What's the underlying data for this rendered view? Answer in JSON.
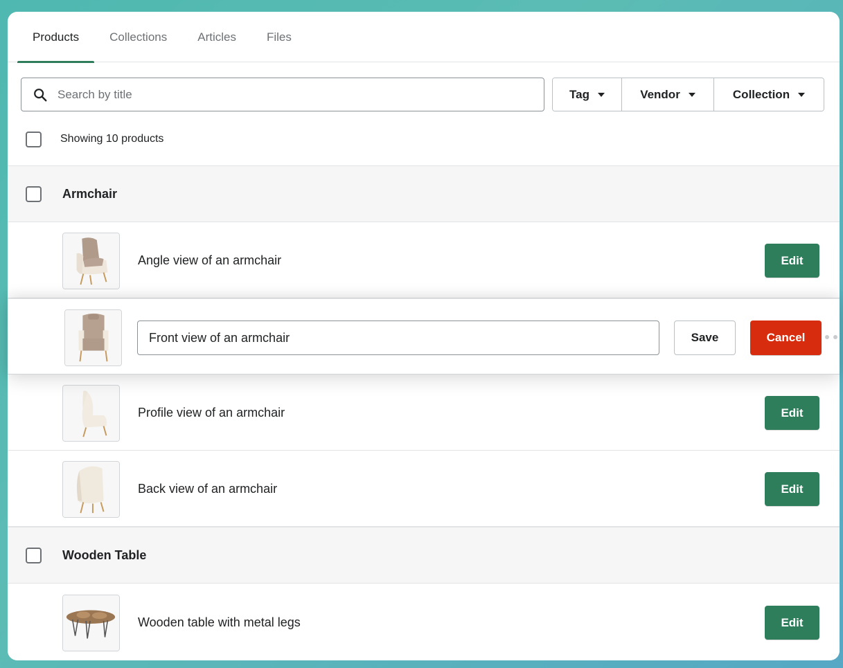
{
  "tabs": [
    {
      "label": "Products",
      "active": true
    },
    {
      "label": "Collections",
      "active": false
    },
    {
      "label": "Articles",
      "active": false
    },
    {
      "label": "Files",
      "active": false
    }
  ],
  "search": {
    "placeholder": "Search by title",
    "value": ""
  },
  "filters": [
    {
      "label": "Tag"
    },
    {
      "label": "Vendor"
    },
    {
      "label": "Collection"
    }
  ],
  "summary": {
    "text": "Showing 10 products"
  },
  "groups": [
    {
      "title": "Armchair"
    },
    {
      "title": "Wooden Table"
    }
  ],
  "rows": [
    {
      "label": "Angle view of an armchair",
      "action": "Edit"
    },
    {
      "label": "Profile view of an armchair",
      "action": "Edit"
    },
    {
      "label": "Back view of an armchair",
      "action": "Edit"
    },
    {
      "label": "Wooden table with metal legs",
      "action": "Edit"
    }
  ],
  "editing": {
    "value": "Front view of an armchair",
    "save_label": "Save",
    "cancel_label": "Cancel"
  },
  "colors": {
    "accent": "#2e7d5b",
    "danger": "#d72c0d",
    "background": "#4fb8b0"
  }
}
